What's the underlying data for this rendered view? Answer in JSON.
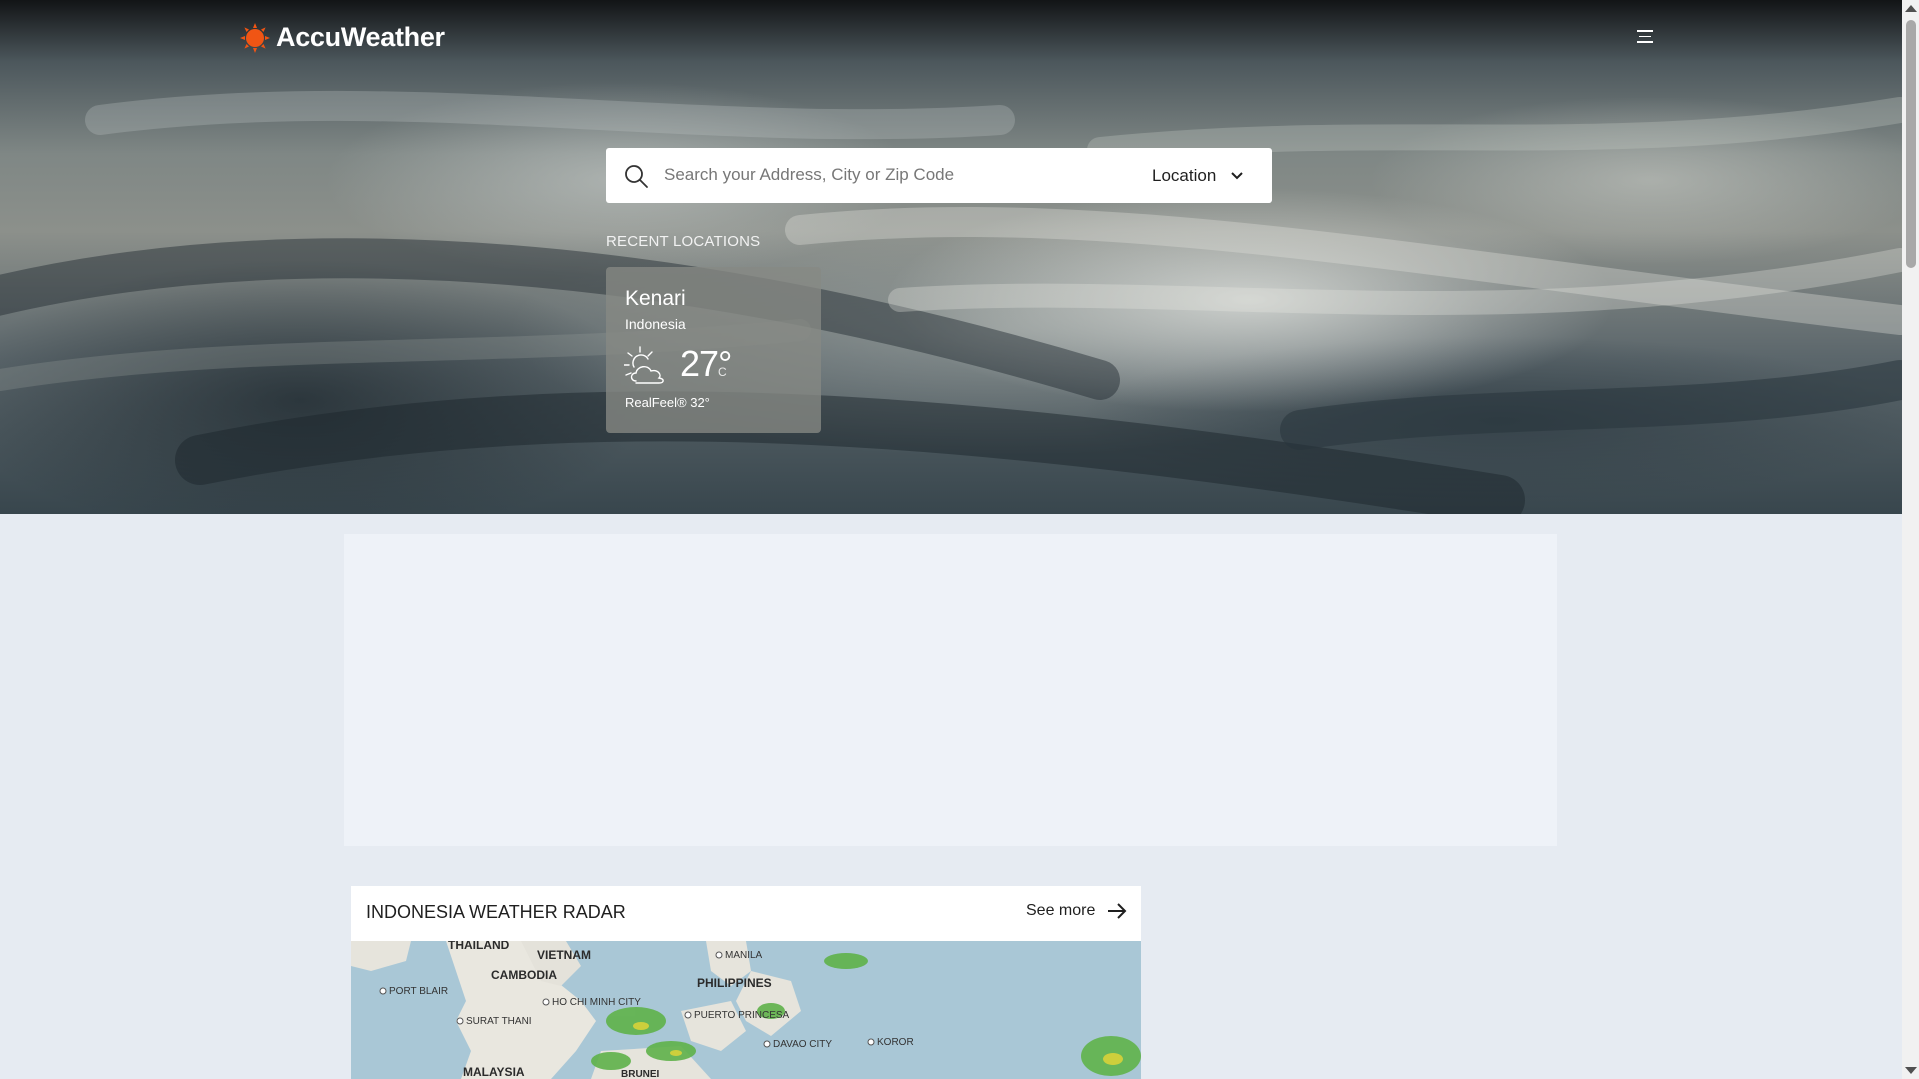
{
  "header": {
    "brand": "AccuWeather",
    "menu_icon": "hamburger-menu-icon",
    "brand_color": "#f05514"
  },
  "search": {
    "placeholder": "Search your Address, City or Zip Code",
    "value": "",
    "type_label": "Location"
  },
  "recent": {
    "title": "RECENT LOCATIONS",
    "items": [
      {
        "city": "Kenari",
        "country": "Indonesia",
        "temp": "27°",
        "unit": "C",
        "realfeel": "RealFeel® 32°",
        "icon": "partly-cloudy-icon"
      }
    ]
  },
  "radar": {
    "title": "INDONESIA WEATHER RADAR",
    "see_more": "See more",
    "map_labels": {
      "thailand": "THAILAND",
      "vietnam": "VIETNAM",
      "cambodia": "CAMBODIA",
      "manila": "MANILA",
      "philippines": "PHILIPPINES",
      "port_blair": "PORT BLAIR",
      "ho_chi_minh": "HO CHI MINH CITY",
      "surat_thani": "SURAT THANI",
      "puerto_princesa": "PUERTO PRINCESA",
      "davao": "DAVAO CITY",
      "koror": "KOROR",
      "malaysia": "MALAYSIA",
      "brunei": "BRUNEI"
    }
  }
}
